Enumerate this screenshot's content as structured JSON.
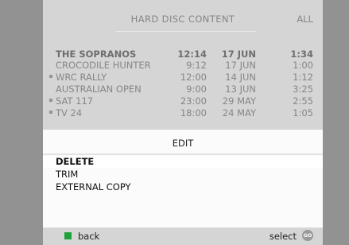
{
  "header": {
    "title": "HARD DISC CONTENT",
    "filter": "ALL"
  },
  "recordings": [
    {
      "name": "THE SOPRANOS",
      "time": "12:14",
      "date": "17 JUN",
      "duration": "1:34",
      "bold": true,
      "marked": false
    },
    {
      "name": "CROCODILE HUNTER",
      "time": "9:12",
      "date": "17 JUN",
      "duration": "1:00",
      "bold": false,
      "marked": false
    },
    {
      "name": "WRC RALLY",
      "time": "12:00",
      "date": "14 JUN",
      "duration": "1:12",
      "bold": false,
      "marked": true
    },
    {
      "name": "AUSTRALIAN OPEN",
      "time": "9:00",
      "date": "13 JUN",
      "duration": "3:25",
      "bold": false,
      "marked": false
    },
    {
      "name": "SAT 117",
      "time": "23:00",
      "date": "29 MAY",
      "duration": "2:55",
      "bold": false,
      "marked": true
    },
    {
      "name": "TV 24",
      "time": "18:00",
      "date": "24 MAY",
      "duration": "1:05",
      "bold": false,
      "marked": true
    }
  ],
  "edit_menu": {
    "title": "EDIT",
    "items": [
      "DELETE",
      "TRIM",
      "EXTERNAL COPY"
    ],
    "selected": "DELETE"
  },
  "footer": {
    "back_label": "back",
    "select_label": "select",
    "go_icon_text": "GO",
    "back_key_color": "#1ea33c"
  }
}
